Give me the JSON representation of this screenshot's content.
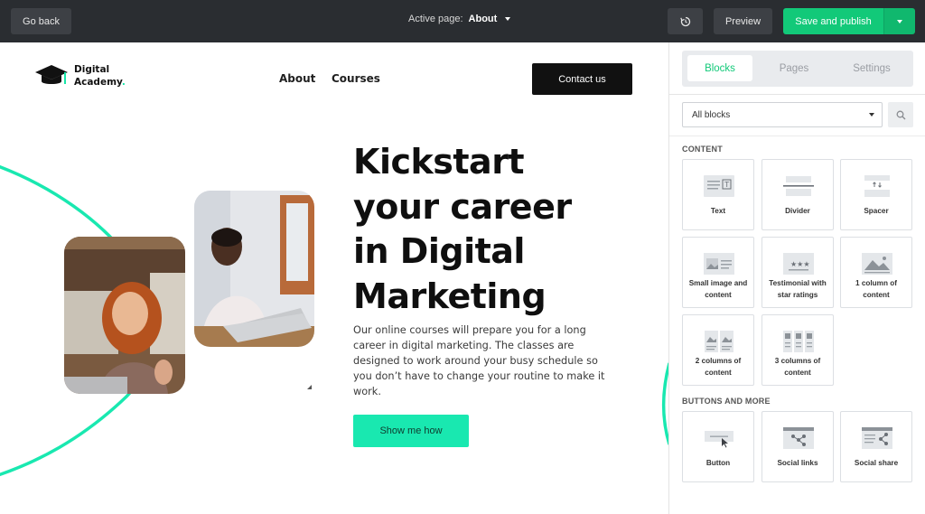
{
  "topbar": {
    "go_back": "Go back",
    "active_page_label": "Active page:",
    "active_page_value": "About",
    "preview": "Preview",
    "publish": "Save and publish"
  },
  "site": {
    "logo_line1": "Digital",
    "logo_line2": "Academy",
    "logo_dot": ".",
    "nav": [
      "About",
      "Courses"
    ],
    "contact": "Contact us",
    "hero_title": [
      "Kickstart",
      "your career",
      "in Digital",
      "Marketing"
    ],
    "hero_body": "Our online courses will prepare you for a long career in digital marketing. The classes are designed to work around your busy schedule so you don’t have to change your routine to make it work.",
    "cta": "Show me how"
  },
  "panel": {
    "tabs": [
      "Blocks",
      "Pages",
      "Settings"
    ],
    "filter_value": "All blocks",
    "sections": [
      {
        "title": "CONTENT",
        "blocks": [
          {
            "label": "Text",
            "icon": "text-block-icon"
          },
          {
            "label": "Divider",
            "icon": "divider-block-icon"
          },
          {
            "label": "Spacer",
            "icon": "spacer-block-icon"
          },
          {
            "label": "Small image and content",
            "icon": "image-content-block-icon"
          },
          {
            "label": "Testimonial with star ratings",
            "icon": "testimonial-block-icon"
          },
          {
            "label": "1 column of content",
            "icon": "one-column-block-icon"
          },
          {
            "label": "2 columns of content",
            "icon": "two-columns-block-icon"
          },
          {
            "label": "3 columns of content",
            "icon": "three-columns-block-icon"
          }
        ]
      },
      {
        "title": "BUTTONS AND MORE",
        "blocks": [
          {
            "label": "Button",
            "icon": "button-block-icon"
          },
          {
            "label": "Social links",
            "icon": "social-links-block-icon"
          },
          {
            "label": "Social share",
            "icon": "social-share-block-icon"
          }
        ]
      }
    ]
  },
  "colors": {
    "topbar": "#2a2d31",
    "publish_green": "#12c979",
    "accent_mint": "#19e8b0"
  }
}
